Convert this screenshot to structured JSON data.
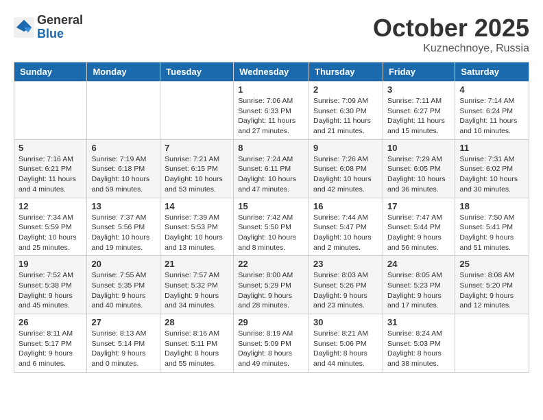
{
  "logo": {
    "general": "General",
    "blue": "Blue"
  },
  "header": {
    "month": "October 2025",
    "location": "Kuznechnoye, Russia"
  },
  "weekdays": [
    "Sunday",
    "Monday",
    "Tuesday",
    "Wednesday",
    "Thursday",
    "Friday",
    "Saturday"
  ],
  "weeks": [
    [
      {
        "day": "",
        "info": ""
      },
      {
        "day": "",
        "info": ""
      },
      {
        "day": "",
        "info": ""
      },
      {
        "day": "1",
        "info": "Sunrise: 7:06 AM\nSunset: 6:33 PM\nDaylight: 11 hours\nand 27 minutes."
      },
      {
        "day": "2",
        "info": "Sunrise: 7:09 AM\nSunset: 6:30 PM\nDaylight: 11 hours\nand 21 minutes."
      },
      {
        "day": "3",
        "info": "Sunrise: 7:11 AM\nSunset: 6:27 PM\nDaylight: 11 hours\nand 15 minutes."
      },
      {
        "day": "4",
        "info": "Sunrise: 7:14 AM\nSunset: 6:24 PM\nDaylight: 11 hours\nand 10 minutes."
      }
    ],
    [
      {
        "day": "5",
        "info": "Sunrise: 7:16 AM\nSunset: 6:21 PM\nDaylight: 11 hours\nand 4 minutes."
      },
      {
        "day": "6",
        "info": "Sunrise: 7:19 AM\nSunset: 6:18 PM\nDaylight: 10 hours\nand 59 minutes."
      },
      {
        "day": "7",
        "info": "Sunrise: 7:21 AM\nSunset: 6:15 PM\nDaylight: 10 hours\nand 53 minutes."
      },
      {
        "day": "8",
        "info": "Sunrise: 7:24 AM\nSunset: 6:11 PM\nDaylight: 10 hours\nand 47 minutes."
      },
      {
        "day": "9",
        "info": "Sunrise: 7:26 AM\nSunset: 6:08 PM\nDaylight: 10 hours\nand 42 minutes."
      },
      {
        "day": "10",
        "info": "Sunrise: 7:29 AM\nSunset: 6:05 PM\nDaylight: 10 hours\nand 36 minutes."
      },
      {
        "day": "11",
        "info": "Sunrise: 7:31 AM\nSunset: 6:02 PM\nDaylight: 10 hours\nand 30 minutes."
      }
    ],
    [
      {
        "day": "12",
        "info": "Sunrise: 7:34 AM\nSunset: 5:59 PM\nDaylight: 10 hours\nand 25 minutes."
      },
      {
        "day": "13",
        "info": "Sunrise: 7:37 AM\nSunset: 5:56 PM\nDaylight: 10 hours\nand 19 minutes."
      },
      {
        "day": "14",
        "info": "Sunrise: 7:39 AM\nSunset: 5:53 PM\nDaylight: 10 hours\nand 13 minutes."
      },
      {
        "day": "15",
        "info": "Sunrise: 7:42 AM\nSunset: 5:50 PM\nDaylight: 10 hours\nand 8 minutes."
      },
      {
        "day": "16",
        "info": "Sunrise: 7:44 AM\nSunset: 5:47 PM\nDaylight: 10 hours\nand 2 minutes."
      },
      {
        "day": "17",
        "info": "Sunrise: 7:47 AM\nSunset: 5:44 PM\nDaylight: 9 hours\nand 56 minutes."
      },
      {
        "day": "18",
        "info": "Sunrise: 7:50 AM\nSunset: 5:41 PM\nDaylight: 9 hours\nand 51 minutes."
      }
    ],
    [
      {
        "day": "19",
        "info": "Sunrise: 7:52 AM\nSunset: 5:38 PM\nDaylight: 9 hours\nand 45 minutes."
      },
      {
        "day": "20",
        "info": "Sunrise: 7:55 AM\nSunset: 5:35 PM\nDaylight: 9 hours\nand 40 minutes."
      },
      {
        "day": "21",
        "info": "Sunrise: 7:57 AM\nSunset: 5:32 PM\nDaylight: 9 hours\nand 34 minutes."
      },
      {
        "day": "22",
        "info": "Sunrise: 8:00 AM\nSunset: 5:29 PM\nDaylight: 9 hours\nand 28 minutes."
      },
      {
        "day": "23",
        "info": "Sunrise: 8:03 AM\nSunset: 5:26 PM\nDaylight: 9 hours\nand 23 minutes."
      },
      {
        "day": "24",
        "info": "Sunrise: 8:05 AM\nSunset: 5:23 PM\nDaylight: 9 hours\nand 17 minutes."
      },
      {
        "day": "25",
        "info": "Sunrise: 8:08 AM\nSunset: 5:20 PM\nDaylight: 9 hours\nand 12 minutes."
      }
    ],
    [
      {
        "day": "26",
        "info": "Sunrise: 8:11 AM\nSunset: 5:17 PM\nDaylight: 9 hours\nand 6 minutes."
      },
      {
        "day": "27",
        "info": "Sunrise: 8:13 AM\nSunset: 5:14 PM\nDaylight: 9 hours\nand 0 minutes."
      },
      {
        "day": "28",
        "info": "Sunrise: 8:16 AM\nSunset: 5:11 PM\nDaylight: 8 hours\nand 55 minutes."
      },
      {
        "day": "29",
        "info": "Sunrise: 8:19 AM\nSunset: 5:09 PM\nDaylight: 8 hours\nand 49 minutes."
      },
      {
        "day": "30",
        "info": "Sunrise: 8:21 AM\nSunset: 5:06 PM\nDaylight: 8 hours\nand 44 minutes."
      },
      {
        "day": "31",
        "info": "Sunrise: 8:24 AM\nSunset: 5:03 PM\nDaylight: 8 hours\nand 38 minutes."
      },
      {
        "day": "",
        "info": ""
      }
    ]
  ]
}
